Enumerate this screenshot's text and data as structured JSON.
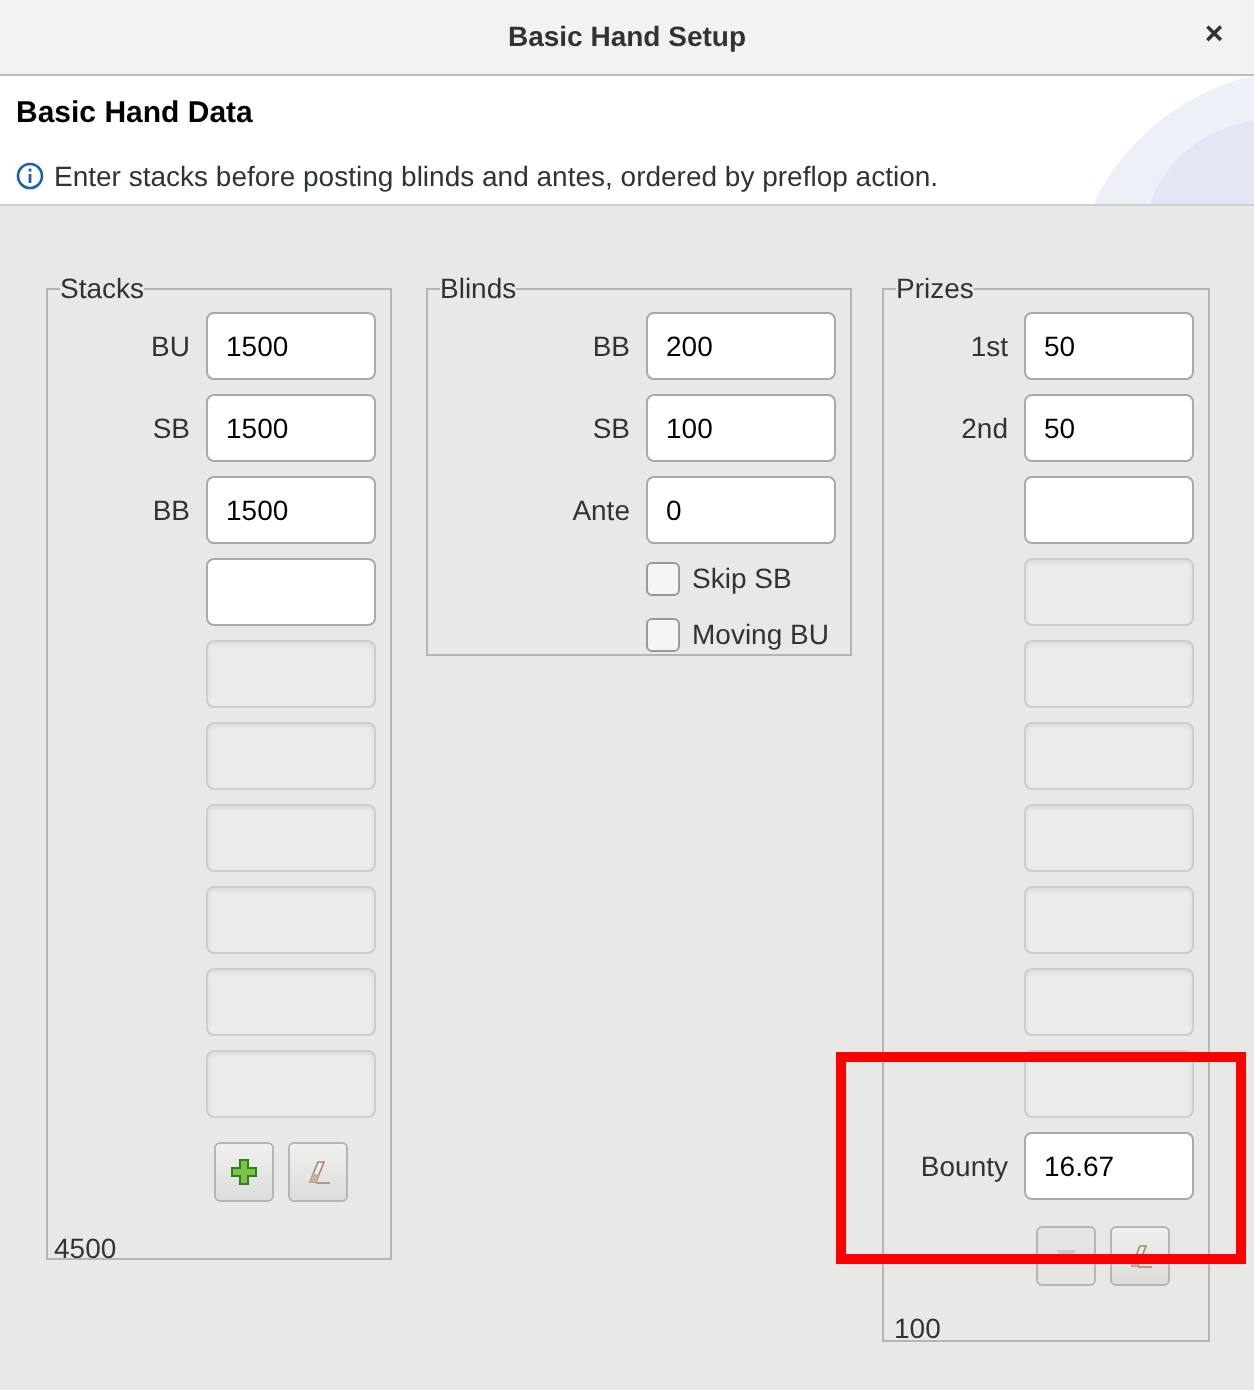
{
  "window": {
    "title": "Basic Hand Setup",
    "close": "×"
  },
  "header": {
    "title": "Basic Hand Data",
    "info": "Enter stacks before posting blinds and antes, ordered by preflop action."
  },
  "stacks": {
    "title": "Stacks",
    "fields": [
      {
        "label": "BU",
        "value": "1500",
        "disabled": false
      },
      {
        "label": "SB",
        "value": "1500",
        "disabled": false
      },
      {
        "label": "BB",
        "value": "1500",
        "disabled": false
      },
      {
        "disabled": false
      },
      {
        "disabled": true
      },
      {
        "disabled": true
      },
      {
        "disabled": true
      },
      {
        "disabled": true
      },
      {
        "disabled": true
      },
      {
        "disabled": true
      }
    ],
    "buttons": [
      {
        "kind": "add",
        "disabled": false
      },
      {
        "kind": "clear",
        "disabled": false
      }
    ],
    "total": "4500"
  },
  "blinds": {
    "title": "Blinds",
    "fields": [
      {
        "label": "BB",
        "value": "200",
        "disabled": false
      },
      {
        "label": "SB",
        "value": "100",
        "disabled": false
      },
      {
        "label": "Ante",
        "value": "0",
        "disabled": false
      }
    ],
    "checkboxes": [
      {
        "label": "Skip SB",
        "checked": false
      },
      {
        "label": "Moving BU",
        "checked": false
      }
    ]
  },
  "prizes": {
    "title": "Prizes",
    "fields": [
      {
        "label": "1st",
        "value": "50",
        "disabled": false
      },
      {
        "label": "2nd",
        "value": "50",
        "disabled": false
      },
      {
        "disabled": false
      },
      {
        "disabled": true
      },
      {
        "disabled": true
      },
      {
        "disabled": true
      },
      {
        "disabled": true
      },
      {
        "disabled": true
      },
      {
        "disabled": true
      },
      {
        "disabled": true
      }
    ],
    "bounty": {
      "label": "Bounty",
      "value": "16.67",
      "disabled": false
    },
    "buttons": [
      {
        "kind": "down",
        "disabled": true
      },
      {
        "kind": "clear",
        "disabled": false
      }
    ],
    "total": "100"
  }
}
